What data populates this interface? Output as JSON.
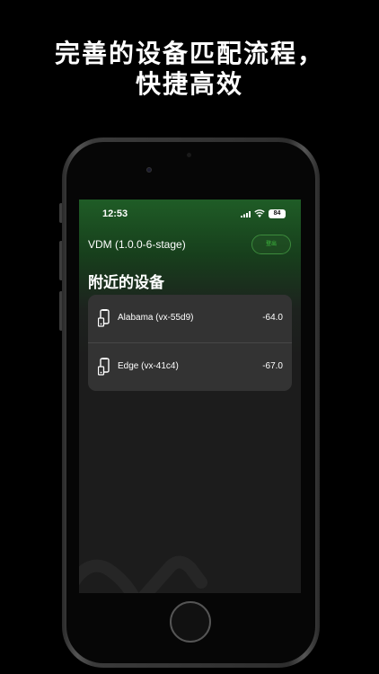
{
  "headline": {
    "line1": "完善的设备匹配流程，",
    "line2": "快捷高效"
  },
  "status_bar": {
    "time": "12:53",
    "battery": "84"
  },
  "app": {
    "title": "VDM (1.0.0-6-stage)",
    "logout_label": "登出",
    "section_title": "附近的设备"
  },
  "devices": [
    {
      "name": "Alabama (vx-55d9)",
      "rssi": "-64.0",
      "icon": "phone-device-icon"
    },
    {
      "name": "Edge (vx-41c4)",
      "rssi": "-67.0",
      "icon": "phone-device-icon"
    }
  ],
  "colors": {
    "accent_green": "#3fbf3f",
    "header_green": "#1f5c26",
    "card_bg": "#333333",
    "screen_bg": "#1c1c1c"
  }
}
